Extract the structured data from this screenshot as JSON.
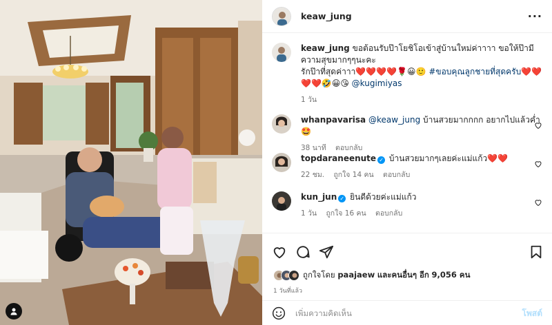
{
  "post": {
    "username": "keaw_jung",
    "caption": {
      "text": "ขอต้อนรับป๊าโยชิโอเข้าสู่บ้านใหม่ค่าาาา ขอให้ป๊ามีความสุขมากๆๆนะคะ",
      "line2_text": "รักป๊าที่สุดค่าาา",
      "line2_emoji": "❤️❤️❤️❤️🌹😀🙂",
      "hashtag": "#ขอบคุณลูกชายที่สุดครับ",
      "hashtag_emoji": "❤️❤️",
      "line3_emoji": "❤️❤️🤣😀😘",
      "mention": "@kugimiyas",
      "time": "1 วัน"
    }
  },
  "comments": [
    {
      "username": "whanpavarisa",
      "mention": "@keaw_jung",
      "text": "บ้านสวยมากกกก อยากไปแล้วค่ำ🤩",
      "verified": false,
      "time": "38 นาที",
      "likes": "",
      "reply": "ตอบกลับ"
    },
    {
      "username": "topdaraneenute",
      "mention": "",
      "text": "บ้านสวยมากๆเลยค่ะแม่แก้ว❤️❤️",
      "verified": true,
      "time": "22 ชม.",
      "likes": "ถูกใจ 14 คน",
      "reply": "ตอบกลับ"
    },
    {
      "username": "kun_jun",
      "mention": "",
      "text": "ยินดีด้วยค่ะแม่แก้ว",
      "verified": true,
      "time": "1 วัน",
      "likes": "ถูกใจ 16 คน",
      "reply": "ตอบกลับ"
    }
  ],
  "likes": {
    "prefix": "ถูกใจโดย",
    "user": "paajaew",
    "middle": "และคนอื่นๆ อีก",
    "count": "9,056 คน"
  },
  "post_time": "1 วันที่แล้ว",
  "add_comment": {
    "placeholder": "เพิ่มความคิดเห็น",
    "post_label": "โพสต์"
  },
  "icons": {
    "more": "more-horizontal-icon",
    "like": "heart-icon",
    "comment": "comment-bubble-icon",
    "share": "paper-plane-icon",
    "save": "bookmark-icon",
    "emoji": "smiley-icon",
    "tag": "person-tag-icon"
  },
  "colors": {
    "text": "#262626",
    "secondary": "#737373",
    "link": "#00376b",
    "verified": "#0095f6",
    "post_disabled": "#b2dffc",
    "like_red": "#ed4956"
  }
}
